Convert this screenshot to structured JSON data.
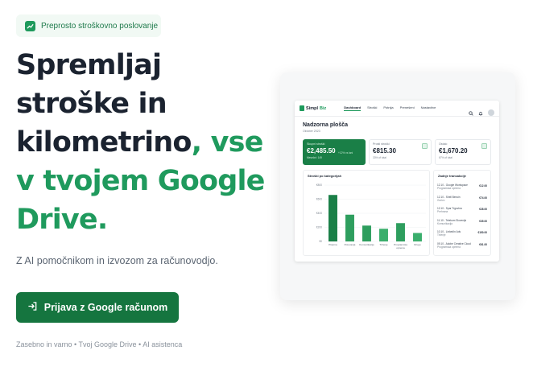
{
  "badge": {
    "icon": "trending-up-icon",
    "text": "Preprosto stroškovno poslovanje"
  },
  "headline": {
    "line1": "Spremljaj",
    "line2": "stroške in",
    "line3_dark": "kilometrino",
    "line3_green": ", vse",
    "line4": "v tvojem Google",
    "line5": "Drive."
  },
  "subtitle": "Z AI pomočnikom in izvozom za računovodjo.",
  "cta": {
    "icon": "sign-in-icon",
    "label": "Prijava z Google računom"
  },
  "footnote": "Zasebno in varno • Tvoj Google Drive • AI asistenca",
  "colors": {
    "brand_green": "#1e9a5c",
    "cta_green": "#15753f",
    "heading_dark": "#1b2330"
  },
  "app": {
    "logo": {
      "simpl": "Simpl",
      "biz": "Biz"
    },
    "nav": [
      "Dashboard",
      "Stroški",
      "Potnija",
      "Prenešeni",
      "Nastavitve"
    ],
    "nav_icons": [
      "search-icon",
      "bell-icon",
      "avatar"
    ],
    "page_title": "Nadzorna plošča",
    "page_date": "Oktober 2023",
    "stats": [
      {
        "label": "Skupni stroški",
        "value": "€2,485.50",
        "change": "+12% vs lani",
        "sub": "Mesečni: 149"
      },
      {
        "label": "Prosti stroški",
        "value": "€815.30",
        "sub": "33% of total"
      },
      {
        "label": "Ostalo",
        "value": "€1,670.20",
        "sub": "67% of total"
      }
    ],
    "chart": {
      "title": "Stroški po kategorijah"
    },
    "transactions": {
      "title": "Zadnje transakcije",
      "items": [
        {
          "date": "12.10",
          "name": "Google Workspace",
          "category": "Programska oprema",
          "amount": "€12.00"
        },
        {
          "date": "12.10",
          "name": "Shell Bencin",
          "category": "Gorivo",
          "amount": "€74.00"
        },
        {
          "date": "12.10",
          "name": "Spar Trgovina",
          "category": "Prehrana",
          "amount": "€28.00"
        },
        {
          "date": "11.10",
          "name": "Telekom Slovenije",
          "category": "Komunikacija",
          "amount": "€35.00"
        },
        {
          "date": "10.10",
          "name": "LinkedIn Ads",
          "category": "Trženje",
          "amount": "€150.00"
        },
        {
          "date": "09.10",
          "name": "Adobe Creative Cloud",
          "category": "Programska oprema",
          "amount": "€61.00"
        }
      ]
    }
  },
  "chart_data": {
    "type": "bar",
    "title": "Stroški po kategorijah",
    "categories": [
      "Pisarna",
      "Potovanja",
      "Komunikacije",
      "Trženje",
      "Programska oprema",
      "Drugo"
    ],
    "values": [
      660,
      380,
      225,
      180,
      260,
      120
    ],
    "y_ticks": [
      "€800",
      "€600",
      "€400",
      "€200",
      "€0"
    ],
    "ylim": [
      0,
      800
    ],
    "grid": true
  }
}
